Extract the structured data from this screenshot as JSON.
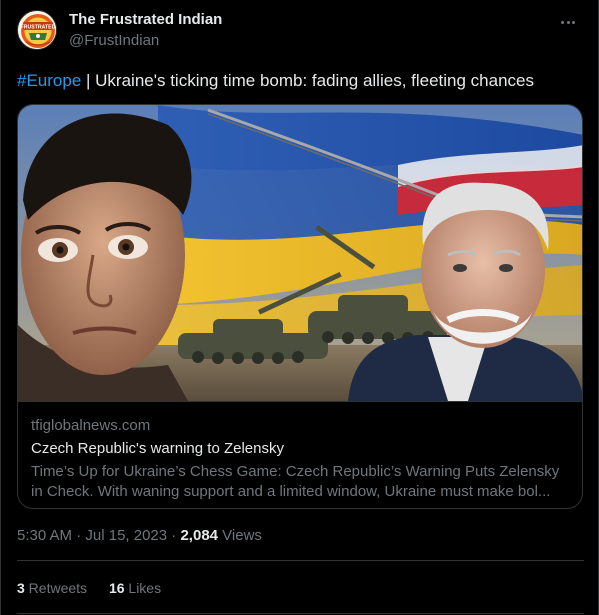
{
  "author": {
    "name": "The Frustrated Indian",
    "handle": "@FrustIndian",
    "avatar_icon": "frustrated-indian-logo",
    "avatar_logo_text": "FRUSTRATED"
  },
  "tweet": {
    "hashtag": "#Europe",
    "text": " | Ukraine's ticking time bomb: fading allies, fleeting chances"
  },
  "card": {
    "domain": "tfiglobalnews.com",
    "title": "Czech Republic's warning to Zelensky",
    "description": "Time’s Up for Ukraine’s Chess Game: Czech Republic’s Warning Puts Zelensky in Check. With waning support and a limited window, Ukraine must make bol..."
  },
  "meta": {
    "time": "5:30 AM",
    "separator": " · ",
    "date": "Jul 15, 2023",
    "views_count": "2,084",
    "views_label": " Views"
  },
  "stats": {
    "retweets_count": "3",
    "retweets_label": " Retweets",
    "likes_count": "16",
    "likes_label": " Likes"
  },
  "colors": {
    "background": "#000000",
    "text": "#e7e9ea",
    "secondary": "#71767b",
    "link": "#1d9bf0",
    "border": "#2f3336"
  }
}
